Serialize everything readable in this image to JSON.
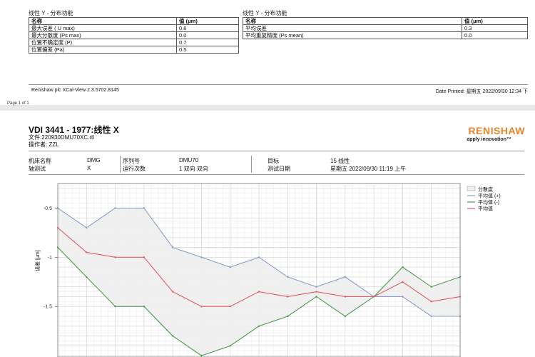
{
  "sheet1": {
    "left_section_title": "线性 Y - 分布功能",
    "right_section_title": "线性 Y - 分布功能",
    "left_table": {
      "header": [
        "名称",
        "值 (μm)"
      ],
      "rows": [
        [
          "最大误差 ( U max)",
          "0.6"
        ],
        [
          "最大分散度 (Ps max)",
          "0.0"
        ],
        [
          "位置不确定度 (P)",
          "0.7"
        ],
        [
          "位置偏差 (Pa)",
          "0.5"
        ]
      ]
    },
    "right_table": {
      "header": [
        "名称",
        "值 (μm)"
      ],
      "rows": [
        [
          "平均误差",
          "0.3"
        ],
        [
          "平均重复精度 (Ps mean)",
          "0.0"
        ]
      ]
    },
    "footer_left": "Renishaw plc XCal-View 2.3.5702.8145",
    "footer_right": "Date Printed: 星期五 2022/09/30 12:34 下",
    "page_number": "Page 1 of 1"
  },
  "report": {
    "title": "VDI 3441 - 1977:线性 X",
    "file": "文件:220930DMU70XC.rtl",
    "operator": "操作者: ZZL",
    "logo": "RENISHAW",
    "logo_tagline": "apply innovation™",
    "info": {
      "machine_name_label": "机床名称",
      "machine_name": "DMG",
      "serial_label": "序列号",
      "serial": "DMU70",
      "target_label": "目标",
      "target": "15 线性",
      "axis_label": "轴测试",
      "axis": "X",
      "runs_label": "运行次数",
      "runs": "1 双向 双向",
      "date_label": "测试日期",
      "date": "星期五 2022/09/30 11:19 上午"
    },
    "y_axis_title": "误差 [μm]"
  },
  "legend": [
    "分散度",
    "平均值 (+)",
    "平均值 (-)",
    "平均值"
  ],
  "colors": {
    "upper": "#8a9ec8",
    "lower": "#4f9a4f",
    "mean": "#e05a6a",
    "band": "#eeeeee",
    "logo": "#e8842b"
  },
  "chart_data": {
    "type": "line",
    "title": "",
    "ylabel": "误差 [μm]",
    "xlabel": "",
    "ylim": [
      -2.05,
      -0.25
    ],
    "yticks": [
      -0.5,
      -1,
      -1.5
    ],
    "ytick_labels": [
      "-0.5",
      "-1",
      "-1.5"
    ],
    "grid": true,
    "legend_position": "top-right",
    "x": [
      0,
      1,
      2,
      3,
      4,
      5,
      6,
      7,
      8,
      9,
      10,
      11,
      12,
      13,
      14
    ],
    "series": [
      {
        "name": "平均值 (+)",
        "values": [
          -0.5,
          -0.7,
          -0.5,
          -0.5,
          -0.9,
          -1.0,
          -1.1,
          -1.0,
          -1.2,
          -1.3,
          -1.2,
          -1.4,
          -1.4,
          -1.6,
          -1.6
        ]
      },
      {
        "name": "平均值 (-)",
        "values": [
          -0.9,
          -1.2,
          -1.5,
          -1.5,
          -1.8,
          -2.0,
          -1.9,
          -1.7,
          -1.6,
          -1.4,
          -1.6,
          -1.4,
          -1.1,
          -1.3,
          -1.2
        ]
      },
      {
        "name": "平均值",
        "values": [
          -0.7,
          -0.95,
          -1.0,
          -1.0,
          -1.35,
          -1.5,
          -1.5,
          -1.35,
          -1.4,
          -1.35,
          -1.4,
          -1.4,
          -1.25,
          -1.45,
          -1.4
        ]
      }
    ]
  }
}
